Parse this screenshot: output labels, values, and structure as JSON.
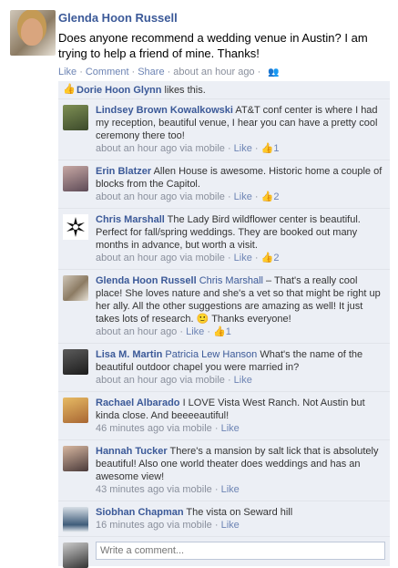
{
  "post": {
    "author": "Glenda Hoon Russell",
    "message": "Does anyone recommend a wedding venue in Austin? I am trying to help a friend of mine. Thanks!",
    "actions": {
      "like": "Like",
      "comment": "Comment",
      "share": "Share",
      "time": "about an hour ago",
      "audience_icon": "friends-icon"
    }
  },
  "likes": {
    "name": "Dorie Hoon Glynn",
    "text": " likes this."
  },
  "comments": [
    {
      "name": "Lindsey Brown Kowalkowski",
      "text": " AT&T conf center is where I had my reception, beautiful venue, I hear you can have a pretty cool ceremony there too!",
      "time": "about an hour ago via mobile",
      "like": "Like",
      "likes": "1"
    },
    {
      "name": "Erin Blatzer",
      "text": " Allen House is awesome. Historic home a couple of blocks from the Capitol.",
      "time": "about an hour ago via mobile",
      "like": "Like",
      "likes": "2"
    },
    {
      "name": "Chris Marshall",
      "text": " The Lady Bird wildflower center is beautiful. Perfect for fall/spring weddings. They are booked out many months in advance, but worth a visit.",
      "time": "about an hour ago via mobile",
      "like": "Like",
      "likes": "2"
    },
    {
      "name": "Glenda Hoon Russell",
      "mention": "Chris Marshall",
      "text": " – That's a really cool place! She loves nature and she's a vet so that might be right up her ally. All the other suggestions are amazing as well! It just takes lots of research. 🙂 Thanks everyone!",
      "time": "about an hour ago",
      "like": "Like",
      "likes": "1"
    },
    {
      "name": "Lisa M. Martin",
      "mention": "Patricia Lew Hanson",
      "text": " What's the name of the beautiful outdoor chapel you were married in?",
      "time": "about an hour ago via mobile",
      "like": "Like"
    },
    {
      "name": "Rachael Albarado",
      "text": " I LOVE Vista West Ranch. Not Austin but kinda close. And beeeeautiful!",
      "time": "46 minutes ago via mobile",
      "like": "Like"
    },
    {
      "name": "Hannah Tucker",
      "text": " There's a mansion by salt lick that is absolutely beautiful! Also one world theater does weddings and has an awesome view!",
      "time": "43 minutes ago via mobile",
      "like": "Like"
    },
    {
      "name": "Siobhan Chapman",
      "text": " The vista on Seward hill",
      "time": "16 minutes ago via mobile",
      "like": "Like"
    }
  ],
  "composer": {
    "placeholder": "Write a comment..."
  }
}
